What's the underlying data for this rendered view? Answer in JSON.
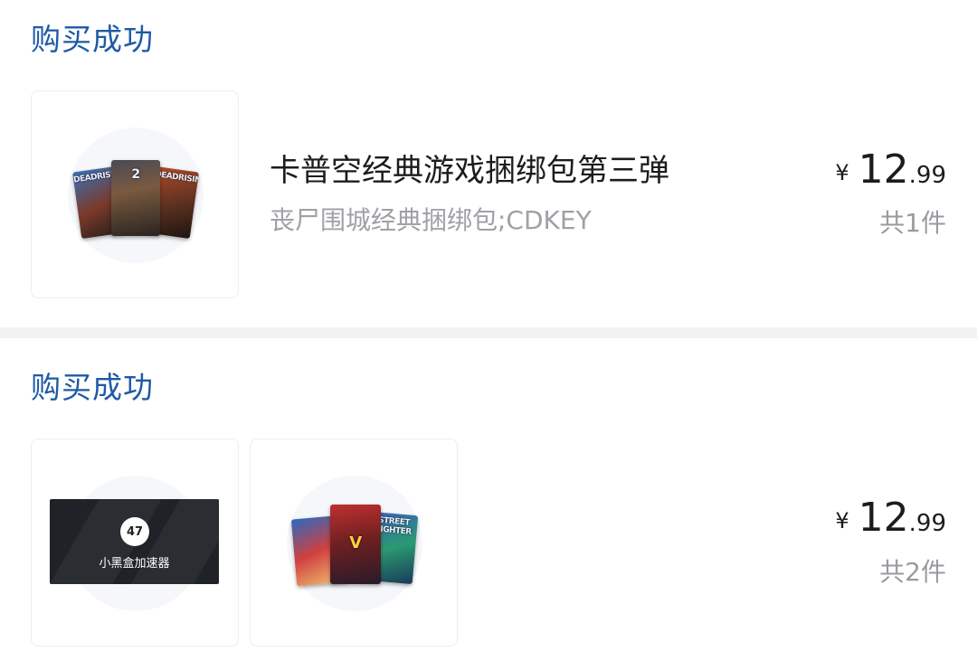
{
  "orders": [
    {
      "status": "购买成功",
      "product": {
        "title": "卡普空经典游戏捆绑包第三弹",
        "subtitle": "丧尸围城经典捆绑包;CDKEY",
        "cover_captions": [
          "DEADRISING",
          "2",
          "DEADRISING"
        ]
      },
      "price": {
        "symbol": "¥",
        "integer": "12",
        "decimal": ".99"
      },
      "count": "共1件"
    },
    {
      "status": "购买成功",
      "items": [
        {
          "name": "小黑盒加速器",
          "logo": "47"
        },
        {
          "cover_captions": [
            "STREET FIGHTER",
            "V"
          ]
        }
      ],
      "price": {
        "symbol": "¥",
        "integer": "12",
        "decimal": ".99"
      },
      "count": "共2件"
    }
  ],
  "colors": {
    "status": "#1e5aa6",
    "divider": "#f2f2f4",
    "title": "#1c1c1e",
    "muted": "#a0a0a6"
  }
}
